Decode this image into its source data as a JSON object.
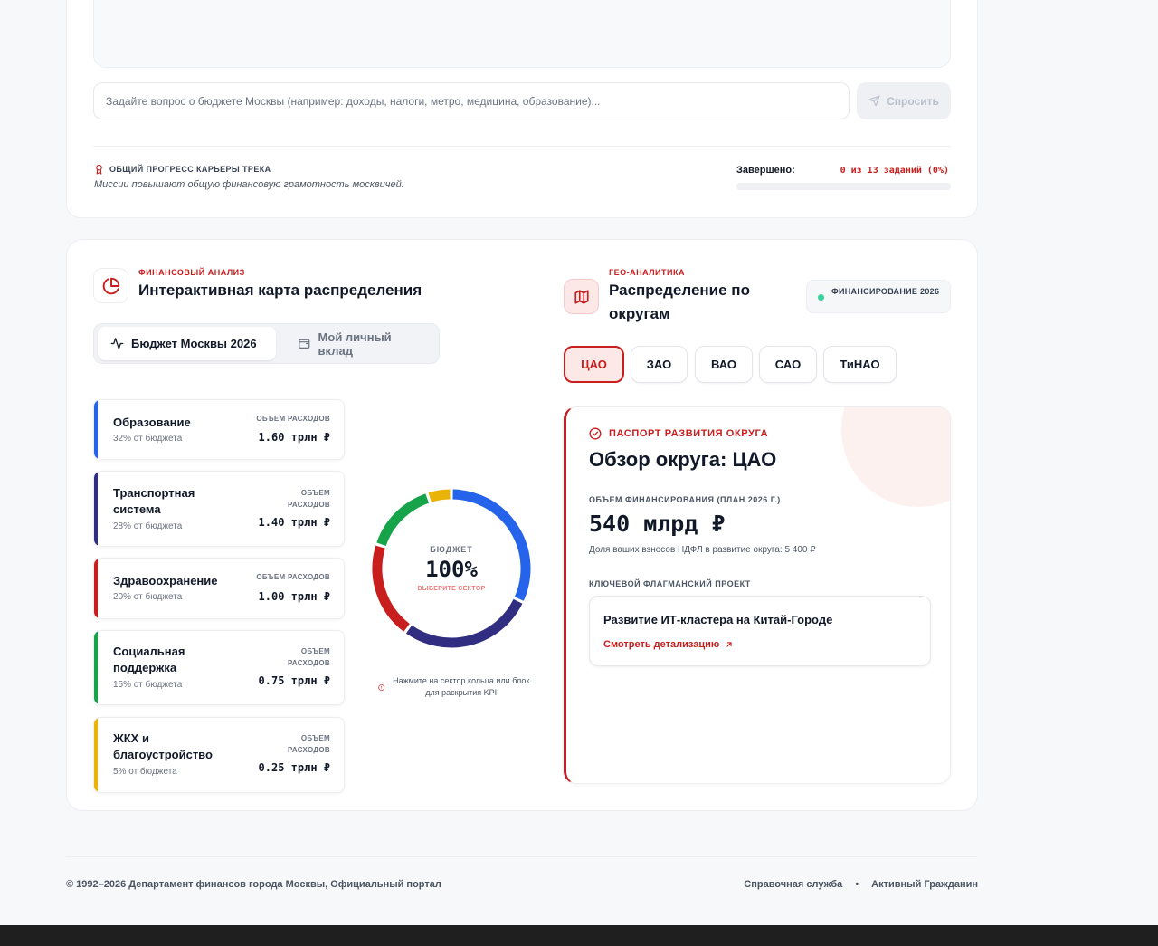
{
  "chat": {
    "placeholder": "Задайте вопрос о бюджете Москвы (например: доходы, налоги, метро, медицина, образование)...",
    "ask_label": "Спросить"
  },
  "progress": {
    "title": "ОБЩИЙ ПРОГРЕСС КАРЬЕРЫ ТРЕКА",
    "subtitle": "Миссии повышают общую финансовую грамотность москвичей.",
    "done_label": "Завершено:",
    "done_value": "0 из 13 заданий (0%)",
    "fraction": 0
  },
  "finance": {
    "kicker": "ФИНАНСОВЫЙ АНАЛИЗ",
    "title": "Интерактивная карта распределения",
    "tabs": [
      {
        "label": "Бюджет Москвы 2026",
        "active": true
      },
      {
        "label": "Мой личный вклад",
        "active": false
      }
    ],
    "sectors": [
      {
        "name": "Образование",
        "pct": "32% от бюджета",
        "vlabel": "ОБЪЕМ РАСХОДОВ",
        "value": "1.60 трлн ₽",
        "color": "#2563eb"
      },
      {
        "name": "Транспортная система",
        "pct": "28% от бюджета",
        "vlabel": "ОБЪЕМ РАСХОДОВ",
        "value": "1.40 трлн ₽",
        "color": "#312e81"
      },
      {
        "name": "Здравоохранение",
        "pct": "20% от бюджета",
        "vlabel": "ОБЪЕМ РАСХОДОВ",
        "value": "1.00 трлн ₽",
        "color": "#c81e1e"
      },
      {
        "name": "Социальная поддержка",
        "pct": "15% от бюджета",
        "vlabel": "ОБЪЕМ РАСХОДОВ",
        "value": "0.75 трлн ₽",
        "color": "#16a34a"
      },
      {
        "name": "ЖКХ и благоустройство",
        "pct": "5% от бюджета",
        "vlabel": "ОБЪЕМ РАСХОДОВ",
        "value": "0.25 трлн ₽",
        "color": "#eab308"
      }
    ],
    "donut": {
      "label": "БЮДЖЕТ",
      "value": "100%",
      "hint": "ВЫБЕРИТЕ СЕКТОР"
    },
    "hint_text": "Нажмите на сектор кольца или блок для раскрытия KPI"
  },
  "chart_data": {
    "type": "pie",
    "categories": [
      "Образование",
      "Транспортная система",
      "Здравоохранение",
      "Социальная поддержка",
      "ЖКХ и благоустройство"
    ],
    "values": [
      32,
      28,
      20,
      15,
      5
    ],
    "colors": [
      "#2563eb",
      "#312e81",
      "#c81e1e",
      "#16a34a",
      "#eab308"
    ]
  },
  "geo": {
    "kicker": "ГЕО-АНАЛИТИКА",
    "title": "Распределение по округам",
    "badge": "ФИНАНСИРОВАНИЕ 2026",
    "districts": [
      {
        "label": "ЦАО",
        "active": true
      },
      {
        "label": "ЗАО",
        "active": false
      },
      {
        "label": "ВАО",
        "active": false
      },
      {
        "label": "САО",
        "active": false
      },
      {
        "label": "ТиНАО",
        "active": false
      }
    ],
    "passport": {
      "kicker": "ПАСПОРТ РАЗВИТИЯ ОКРУГА",
      "title": "Обзор округа: ЦАО",
      "funding_label": "ОБЪЕМ ФИНАНСИРОВАНИЯ (ПЛАН 2026 Г.)",
      "amount": "540 млрд ₽",
      "share": "Доля ваших взносов НДФЛ в развитие округа: 5 400 ₽",
      "project_label": "КЛЮЧЕВОЙ ФЛАГМАНСКИЙ ПРОЕКТ",
      "project_name": "Развитие ИТ-кластера на Китай-Городе",
      "project_link": "Смотреть детализацию"
    }
  },
  "footer": {
    "copyright": "© 1992–2026 Департамент финансов города Москвы, Официальный портал",
    "links": [
      "Справочная служба",
      "Активный Гражданин"
    ],
    "separator": "•"
  }
}
